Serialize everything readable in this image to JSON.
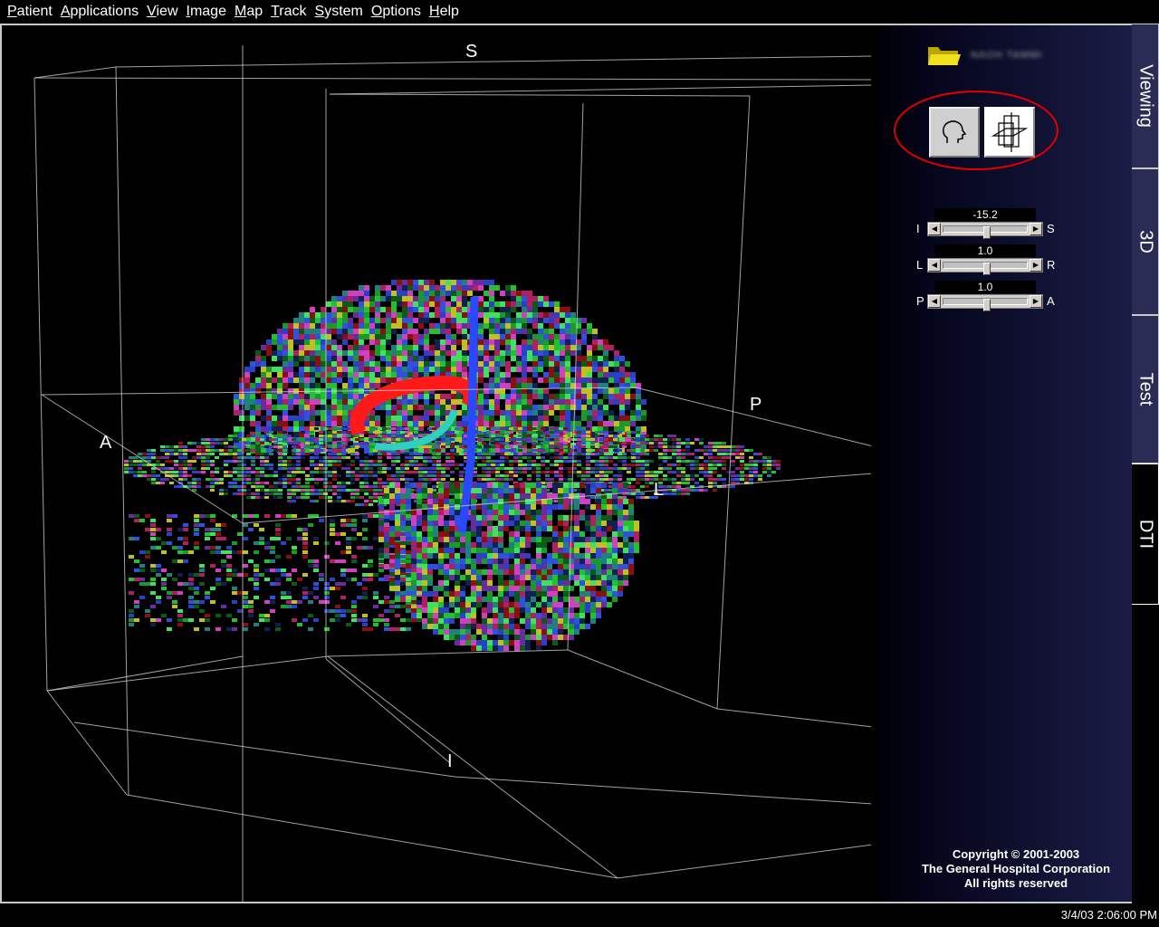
{
  "menu": {
    "items": [
      "Patient",
      "Applications",
      "View",
      "Image",
      "Map",
      "Track",
      "System",
      "Options",
      "Help"
    ]
  },
  "viewport": {
    "labels": {
      "superior": "S",
      "inferior": "I",
      "anterior": "A",
      "posterior": "P",
      "left": "L"
    }
  },
  "panel": {
    "patient_icon": "folder-icon",
    "patient_name": "NAOH TAMMI",
    "buttons": [
      {
        "name": "head-view-button",
        "icon": "head-icon"
      },
      {
        "name": "slice-planes-button",
        "icon": "planes-icon"
      }
    ],
    "highlight_color": "#e00000",
    "sliders": [
      {
        "left": "I",
        "right": "S",
        "value": "-15.2",
        "position": 0.51
      },
      {
        "left": "L",
        "right": "R",
        "value": "1.0",
        "position": 0.51
      },
      {
        "left": "P",
        "right": "A",
        "value": "1.0",
        "position": 0.51
      }
    ],
    "copyright": [
      "Copyright © 2001-2003",
      "The General Hospital Corporation",
      "All rights reserved"
    ]
  },
  "tabs": [
    {
      "label": "Viewing",
      "active": false
    },
    {
      "label": "3D",
      "active": false
    },
    {
      "label": "Test",
      "active": false
    },
    {
      "label": "DTI",
      "active": true
    }
  ],
  "status": {
    "timestamp": "3/4/03 2:06:00 PM"
  }
}
